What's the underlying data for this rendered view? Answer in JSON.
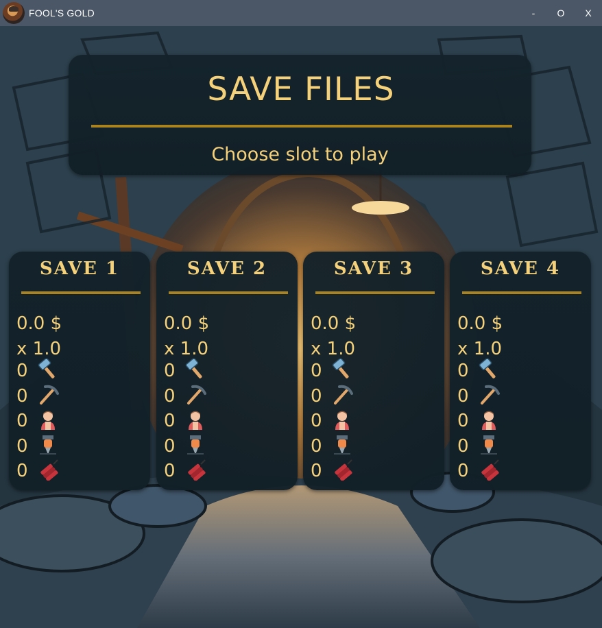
{
  "window": {
    "title": "FOOL'S GOLD",
    "controls": {
      "minimize": "-",
      "maximize": "O",
      "close": "X"
    }
  },
  "header": {
    "title": "SAVE FILES",
    "subtitle": "Choose slot to play"
  },
  "slots": [
    {
      "title": "SAVE 1",
      "money": "0.0 $",
      "multiplier": "x 1.0",
      "hammers": "0",
      "pickaxes": "0",
      "workers": "0",
      "drills": "0",
      "dynamite": "0"
    },
    {
      "title": "SAVE 2",
      "money": "0.0 $",
      "multiplier": "x 1.0",
      "hammers": "0",
      "pickaxes": "0",
      "workers": "0",
      "drills": "0",
      "dynamite": "0"
    },
    {
      "title": "SAVE 3",
      "money": "0.0 $",
      "multiplier": "x 1.0",
      "hammers": "0",
      "pickaxes": "0",
      "workers": "0",
      "drills": "0",
      "dynamite": "0"
    },
    {
      "title": "SAVE 4",
      "money": "0.0 $",
      "multiplier": "x 1.0",
      "hammers": "0",
      "pickaxes": "0",
      "workers": "0",
      "drills": "0",
      "dynamite": "0"
    }
  ],
  "icons": [
    "hammer-icon",
    "pickaxe-icon",
    "worker-icon",
    "drill-icon",
    "dynamite-icon"
  ],
  "colors": {
    "accent_text": "#f4d17a",
    "rule": "#a98322",
    "panel": "#13222a",
    "titlebar": "#4b5766"
  }
}
